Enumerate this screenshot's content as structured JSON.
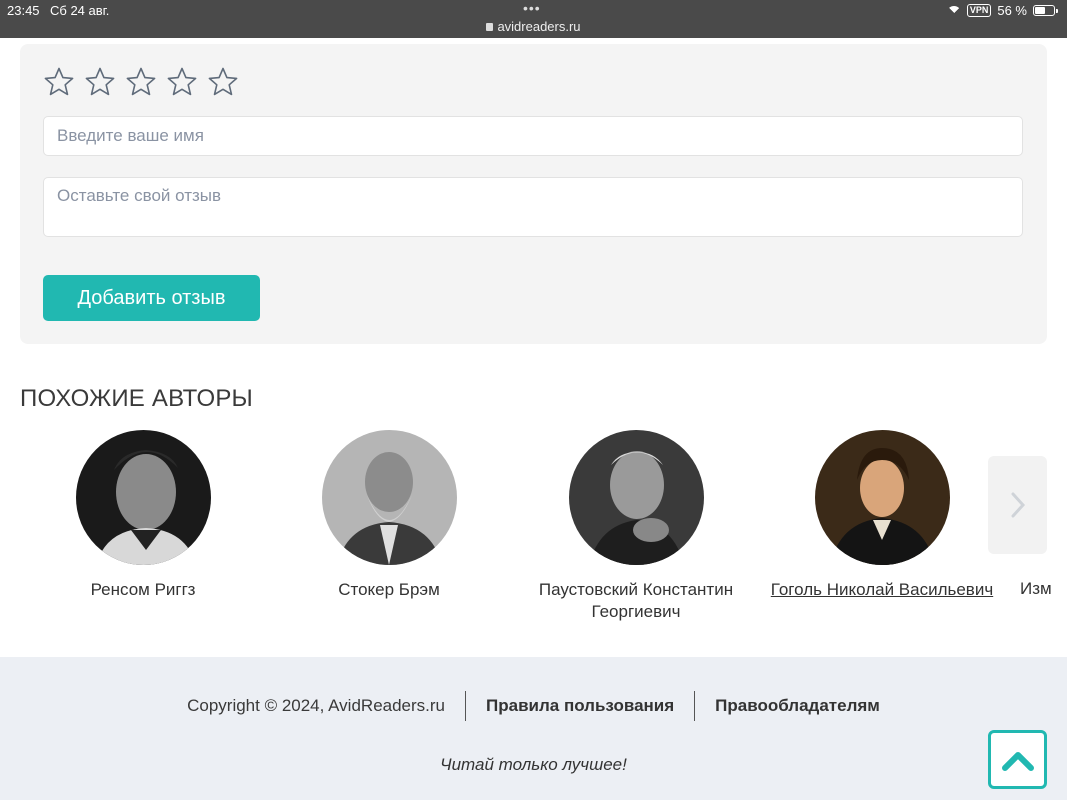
{
  "status_bar": {
    "time": "23:45",
    "date": "Сб 24 авг.",
    "url": "avidreaders.ru",
    "vpn": "VPN",
    "battery": "56 %",
    "battery_level": 0.56
  },
  "review_form": {
    "rating_stars": 5,
    "name_placeholder": "Введите ваше имя",
    "review_placeholder": "Оставьте свой отзыв",
    "submit_label": "Добавить отзыв"
  },
  "similar_authors": {
    "title": "ПОХОЖИЕ АВТОРЫ",
    "authors": [
      {
        "name": "Ренсом Риггз"
      },
      {
        "name": "Стокер Брэм"
      },
      {
        "name": "Паустовский Константин Георгиевич"
      },
      {
        "name": "Гоголь Николай Васильевич"
      }
    ],
    "partial_next": "Изм"
  },
  "footer": {
    "copyright": "Copyright © 2024, AvidReaders.ru",
    "terms": "Правила пользования",
    "rights_holders": "Правообладателям",
    "slogan": "Читай только лучшее!"
  },
  "colors": {
    "accent": "#21b8b1",
    "footer_bg": "#eceff4",
    "card_bg": "#f4f4f4"
  }
}
